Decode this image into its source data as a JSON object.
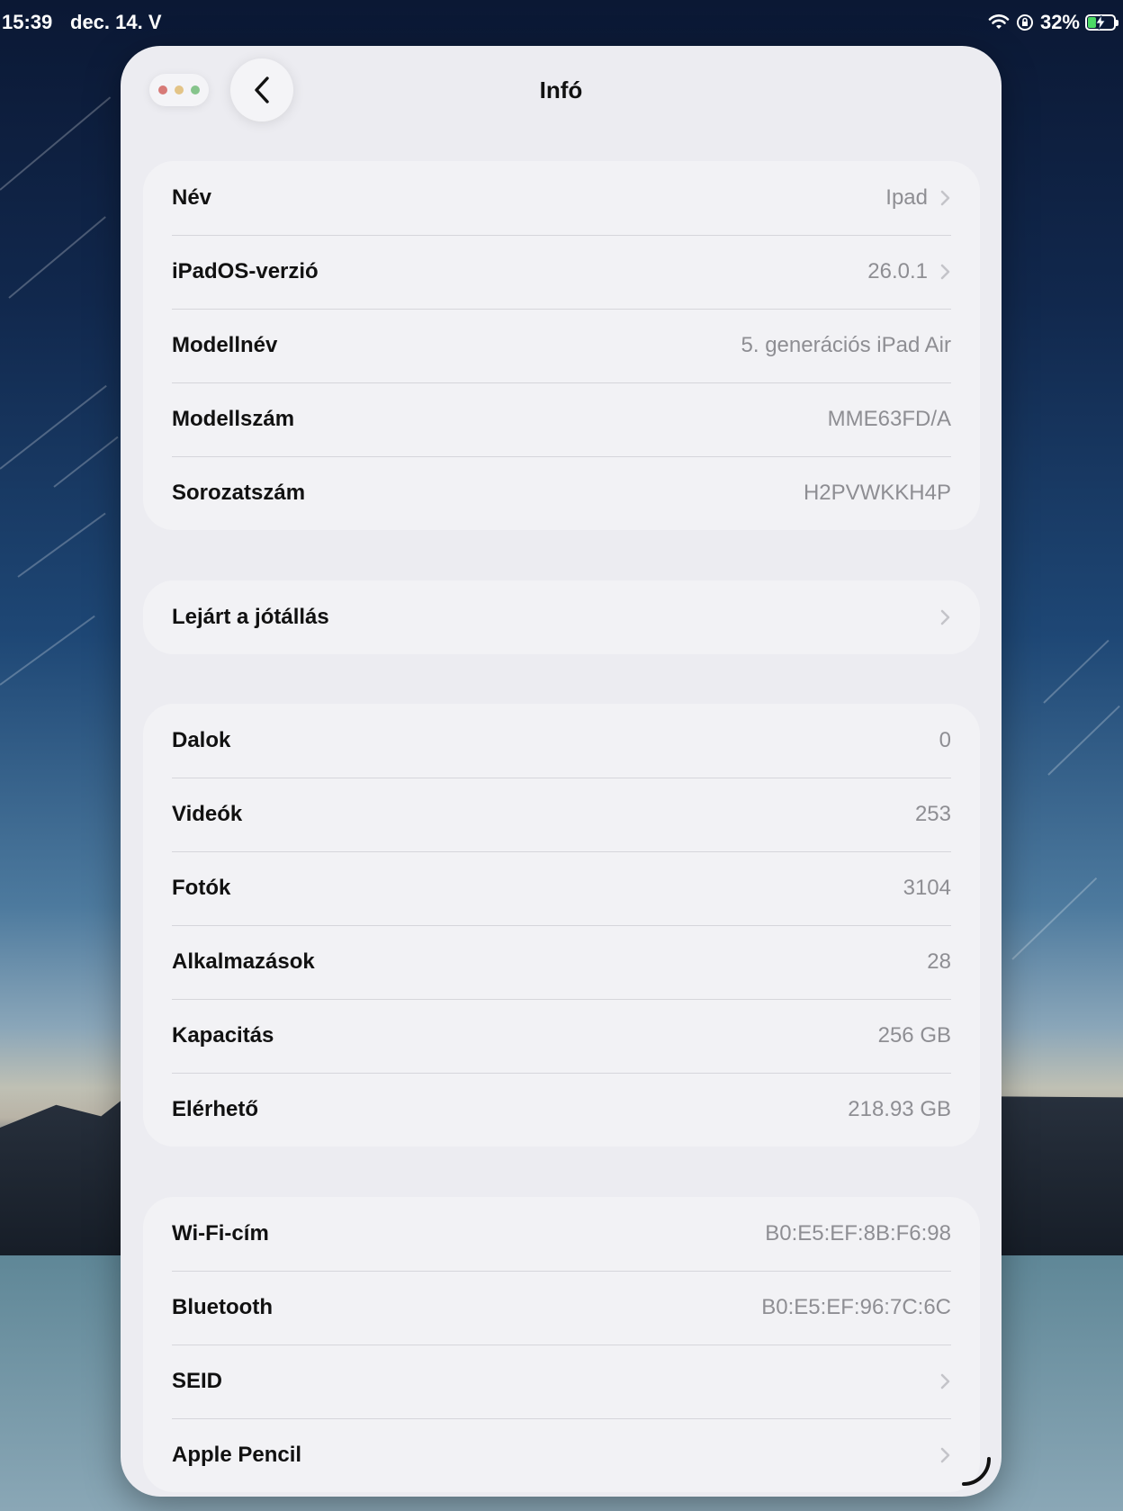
{
  "status_bar": {
    "time": "15:39",
    "date": "dec. 14. V",
    "battery": "32%",
    "battery_level": 0.32
  },
  "header": {
    "title": "Infó"
  },
  "groups": [
    {
      "rows": [
        {
          "label": "Név",
          "value": "Ipad",
          "chevron": true
        },
        {
          "label": "iPadOS-verzió",
          "value": "26.0.1",
          "chevron": true
        },
        {
          "label": "Modellnév",
          "value": "5. generációs iPad Air",
          "chevron": false
        },
        {
          "label": "Modellszám",
          "value": "MME63FD/A",
          "chevron": false
        },
        {
          "label": "Sorozatszám",
          "value": "H2PVWKKH4P",
          "chevron": false
        }
      ]
    },
    {
      "rows": [
        {
          "label": "Lejárt a jótállás",
          "value": "",
          "chevron": true
        }
      ]
    },
    {
      "rows": [
        {
          "label": "Dalok",
          "value": "0",
          "chevron": false
        },
        {
          "label": "Videók",
          "value": "253",
          "chevron": false
        },
        {
          "label": "Fotók",
          "value": "3104",
          "chevron": false
        },
        {
          "label": "Alkalmazások",
          "value": "28",
          "chevron": false
        },
        {
          "label": "Kapacitás",
          "value": "256 GB",
          "chevron": false
        },
        {
          "label": "Elérhető",
          "value": "218.93 GB",
          "chevron": false
        }
      ]
    },
    {
      "rows": [
        {
          "label": "Wi-Fi-cím",
          "value": "B0:E5:EF:8B:F6:98",
          "chevron": false
        },
        {
          "label": "Bluetooth",
          "value": "B0:E5:EF:96:7C:6C",
          "chevron": false
        },
        {
          "label": "SEID",
          "value": "",
          "chevron": true
        },
        {
          "label": "Apple Pencil",
          "value": "",
          "chevron": true
        }
      ]
    }
  ],
  "colors": {
    "close": "#e0443e",
    "minimize": "#dea123",
    "zoom": "#1aab29",
    "chevron": "#c4c4c9"
  },
  "icons": {
    "back": "chevron-left-icon",
    "row_chevron": "chevron-right-icon",
    "wifi": "wifi-icon",
    "orientation_lock": "orientation-lock-icon",
    "battery": "battery-charging-icon"
  }
}
